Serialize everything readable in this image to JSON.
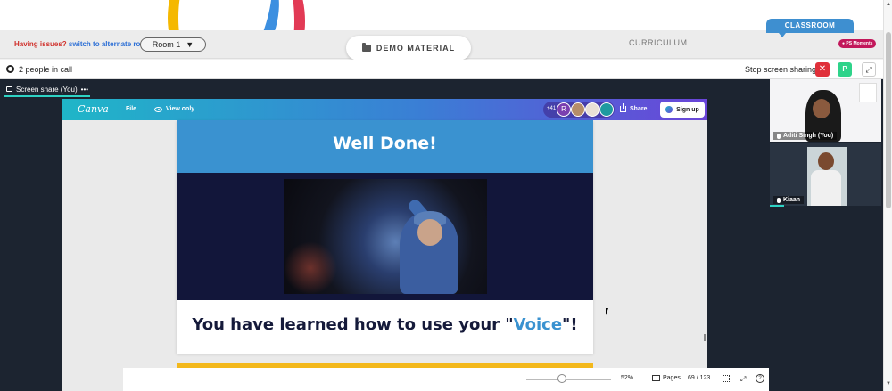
{
  "tabbar": {
    "issues_text": "Having issues?",
    "issues_link": "switch to alternate room",
    "room_select": "Room 1",
    "demo_tab": "DEMO MATERIAL",
    "curriculum_tab": "CURRICULUM",
    "classroom_tab": "CLASSROOM",
    "ps_moments": "PS Moments"
  },
  "callbar": {
    "people_count": "2 people in call",
    "stop_sharing": "Stop screen sharing",
    "stop_btn": "✕",
    "p_btn": "P",
    "expand_btn": "⤢"
  },
  "stage": {
    "share_label": "Screen share (You)",
    "more": "•••"
  },
  "canva": {
    "logo": "Canva",
    "file": "File",
    "view_only": "View only",
    "avatar_count": "+41",
    "avatar_r": "R",
    "share": "Share",
    "signup": "Sign up",
    "slide_title": "Well Done!",
    "slide_text_before": "You have learned how to use your \"",
    "slide_text_highlight": "Voice",
    "slide_text_after": "\"!",
    "zoom": "52%",
    "pages": "Pages",
    "page_count": "69 / 123",
    "zoom_level": 0.42
  },
  "participants": [
    {
      "name": "Aditi Singh (You)"
    },
    {
      "name": "Kiaan"
    }
  ],
  "colors": {
    "accent_teal": "#2ed3c4",
    "stop_red": "#e0303a",
    "slide_blue": "#3a92d0",
    "classroom_blue": "#3e8fd0",
    "progress_yellow": "#f3b81b"
  }
}
